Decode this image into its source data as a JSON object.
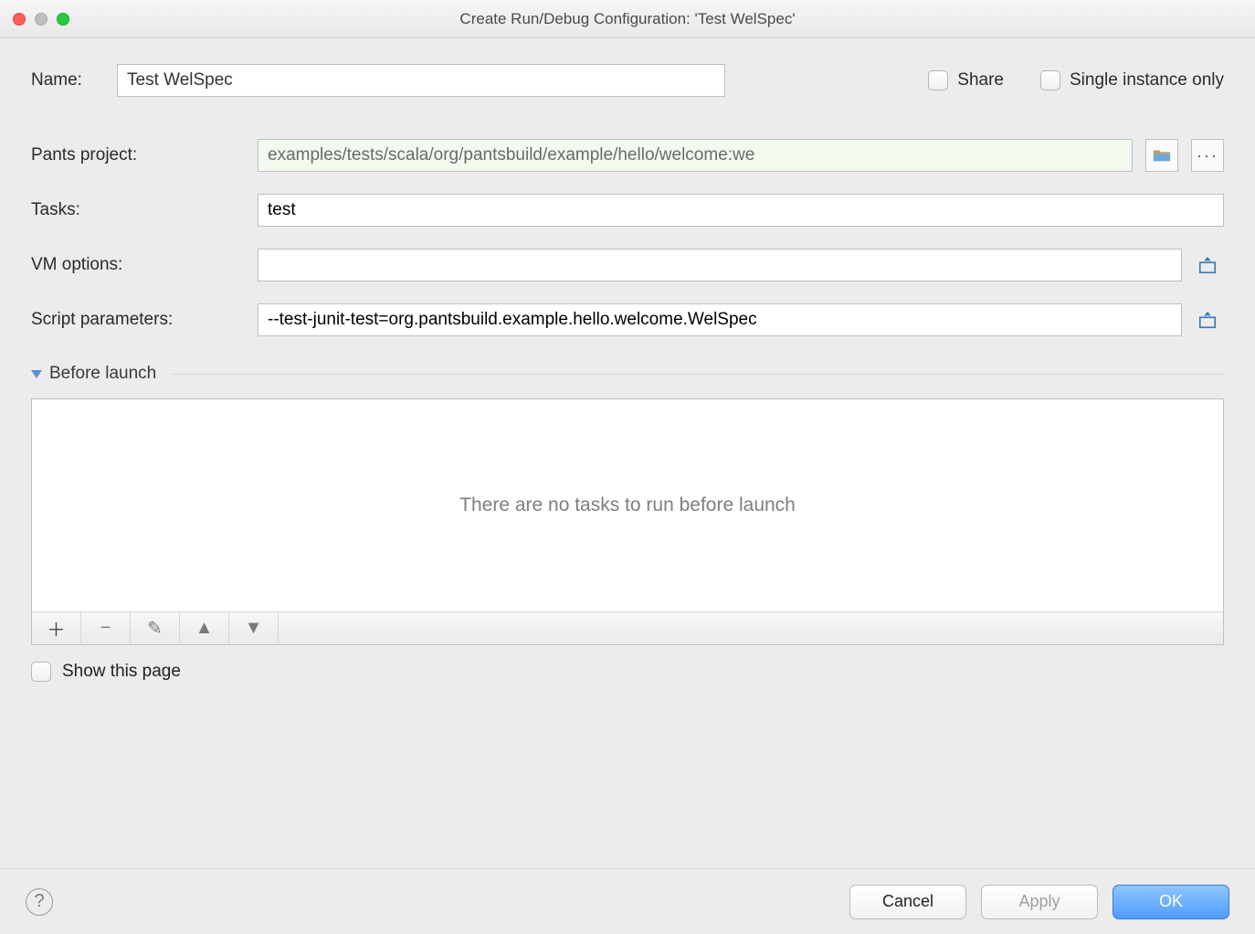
{
  "window": {
    "title": "Create Run/Debug Configuration: 'Test WelSpec'"
  },
  "form": {
    "name_label": "Name:",
    "name_value": "Test WelSpec",
    "share_label": "Share",
    "single_instance_label": "Single instance only",
    "pants_project_label": "Pants project:",
    "pants_project_value": "examples/tests/scala/org/pantsbuild/example/hello/welcome:we",
    "tasks_label": "Tasks:",
    "tasks_value": "test",
    "vm_options_label": "VM options:",
    "vm_options_value": "",
    "script_params_label": "Script parameters:",
    "script_params_value": "--test-junit-test=org.pantsbuild.example.hello.welcome.WelSpec"
  },
  "before_launch": {
    "section_title": "Before launch",
    "empty_text": "There are no tasks to run before launch"
  },
  "show_this_page_label": "Show this page",
  "footer": {
    "cancel": "Cancel",
    "apply": "Apply",
    "ok": "OK"
  }
}
